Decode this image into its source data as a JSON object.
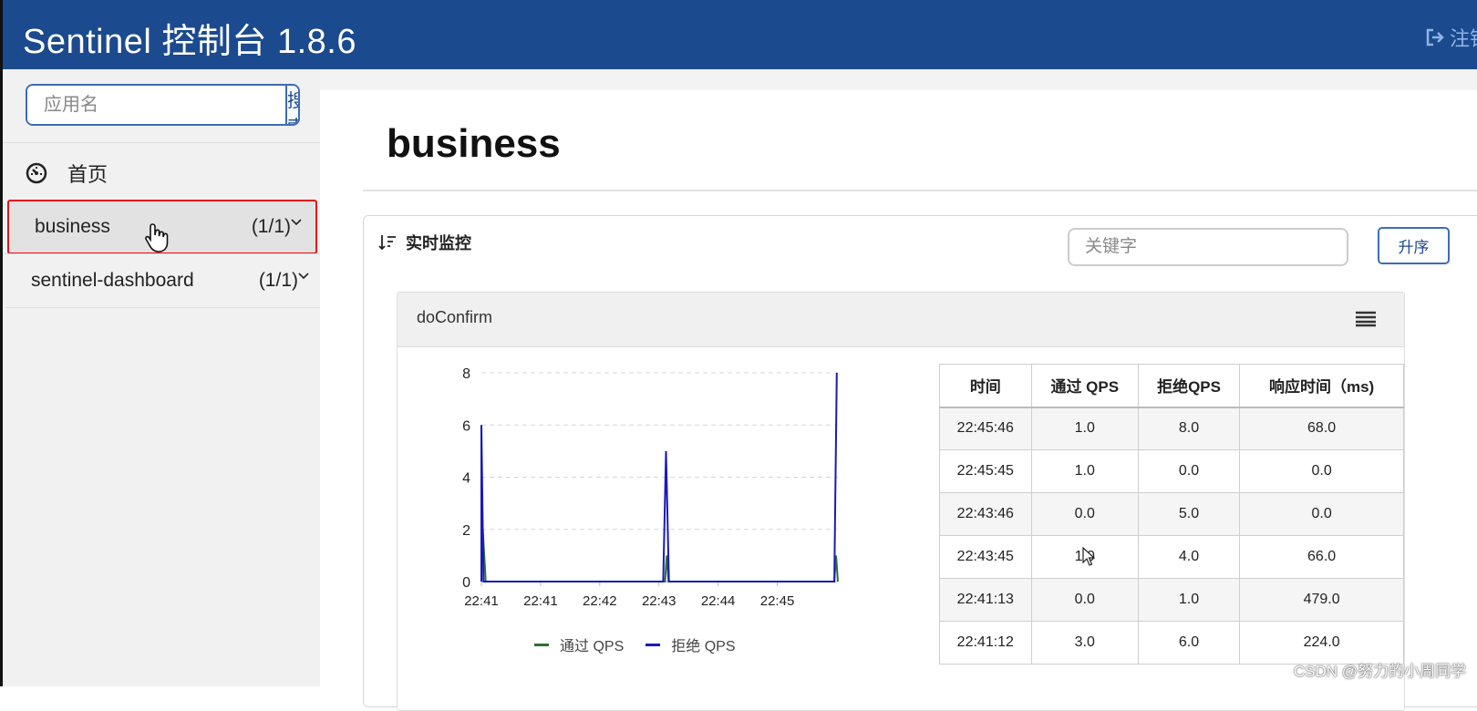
{
  "header": {
    "title": "Sentinel 控制台 1.8.6",
    "logout_label": "注销"
  },
  "sidebar": {
    "search_placeholder": "应用名",
    "search_button": "搜索",
    "home_label": "首页",
    "apps": [
      {
        "name": "business",
        "count": "(1/1)",
        "active": true
      },
      {
        "name": "sentinel-dashboard",
        "count": "(1/1)",
        "active": false
      }
    ]
  },
  "main": {
    "page_title": "business",
    "panel_title": "实时监控",
    "keyword_placeholder": "关键字",
    "sort_button": "升序",
    "resource": {
      "name": "doConfirm",
      "table_headers": [
        "时间",
        "通过 QPS",
        "拒绝QPS",
        "响应时间（ms)"
      ],
      "rows": [
        [
          "22:45:46",
          "1.0",
          "8.0",
          "68.0"
        ],
        [
          "22:45:45",
          "1.0",
          "0.0",
          "0.0"
        ],
        [
          "22:43:46",
          "0.0",
          "5.0",
          "0.0"
        ],
        [
          "22:43:45",
          "1.0",
          "4.0",
          "66.0"
        ],
        [
          "22:41:13",
          "0.0",
          "1.0",
          "479.0"
        ],
        [
          "22:41:12",
          "3.0",
          "6.0",
          "224.0"
        ]
      ]
    }
  },
  "chart_data": {
    "type": "line",
    "x_tick_labels": [
      "22:41",
      "22:41",
      "22:42",
      "22:43",
      "22:44",
      "22:45"
    ],
    "y_ticks": [
      0,
      2,
      4,
      6,
      8
    ],
    "ylim": [
      0,
      8
    ],
    "grid": true,
    "legend_position": "bottom",
    "series": [
      {
        "name": "通过 QPS",
        "color": "#2f6f2f",
        "points": [
          [
            0,
            0
          ],
          [
            0.0,
            3
          ],
          [
            0.012,
            0
          ],
          [
            0.515,
            0
          ],
          [
            0.52,
            1
          ],
          [
            0.525,
            0
          ],
          [
            0.99,
            0
          ],
          [
            0.995,
            1
          ],
          [
            1.0,
            0
          ]
        ]
      },
      {
        "name": "拒绝 QPS",
        "color": "#1a1ab8",
        "points": [
          [
            0,
            0
          ],
          [
            0.0,
            6
          ],
          [
            0.006,
            0
          ],
          [
            0.51,
            0
          ],
          [
            0.518,
            5
          ],
          [
            0.526,
            0
          ],
          [
            0.99,
            0
          ],
          [
            0.997,
            8
          ]
        ]
      }
    ]
  },
  "watermark": "CSDN @努力的小周同学"
}
